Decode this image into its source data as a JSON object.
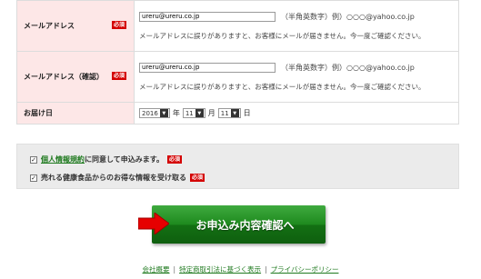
{
  "form": {
    "required_badge": "必須",
    "email": {
      "label": "メールアドレス",
      "value": "ureru@ureru.co.jp",
      "hint": "（半角英数字）例）○○○@yahoo.co.jp",
      "note": "メールアドレスに誤りがありますと、お客様にメールが届きません。今一度ご確認ください。"
    },
    "email_confirm": {
      "label": "メールアドレス（確認）",
      "value": "ureru@ureru.co.jp",
      "hint": "（半角英数字）例）○○○@yahoo.co.jp",
      "note": "メールアドレスに誤りがありますと、お客様にメールが届きません。今一度ご確認ください。"
    },
    "delivery_date": {
      "label": "お届け日",
      "year": "2016",
      "year_unit": "年",
      "month": "11",
      "month_unit": "月",
      "day": "11",
      "day_unit": "日"
    }
  },
  "agreements": {
    "privacy": {
      "checked": true,
      "link_text": "個人情報規約",
      "rest_text": "に同意して申込みます。"
    },
    "newsletter": {
      "checked": true,
      "text": "売れる健康食品からのお得な情報を受け取る"
    }
  },
  "cta": {
    "label": "お申込み内容確認へ"
  },
  "footer": {
    "links": [
      "会社概要",
      "特定商取引法に基づく表示",
      "プライバシーポリシー"
    ],
    "separator": "|"
  },
  "colors": {
    "label_bg": "#fde7e7",
    "required": "#d40000",
    "cta_green": "#1e8a1e",
    "link_green": "#1f7a1f"
  }
}
